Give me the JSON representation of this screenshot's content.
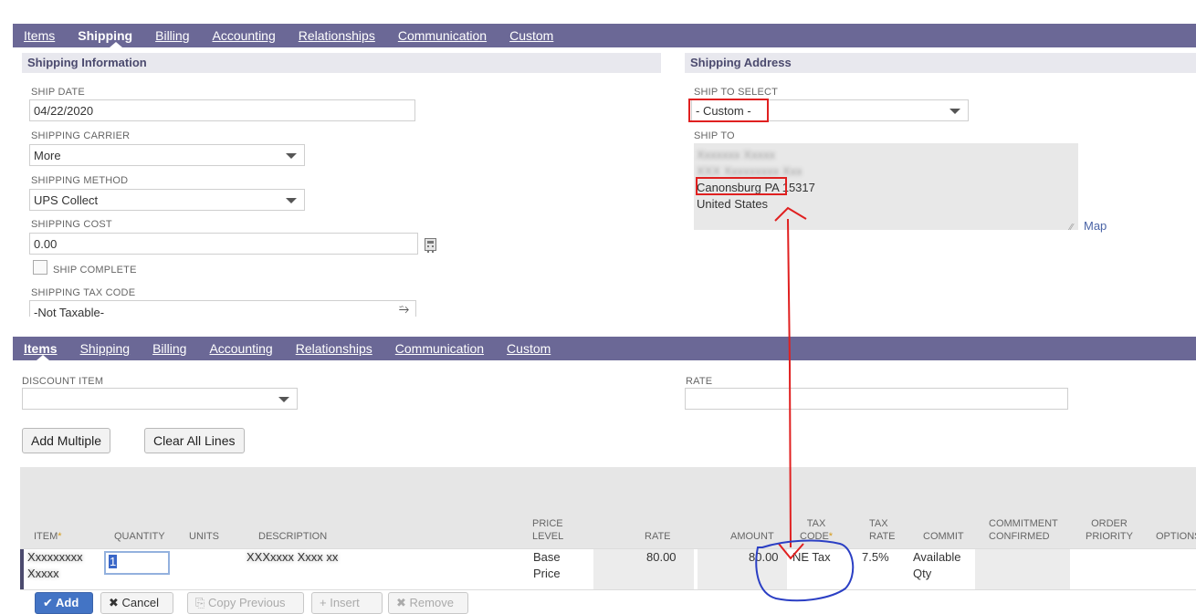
{
  "tabs_top": {
    "items": [
      {
        "label": "Items",
        "active": false
      },
      {
        "label": "Shipping",
        "active": true
      },
      {
        "label": "Billing",
        "active": false
      },
      {
        "label": "Accounting",
        "active": false
      },
      {
        "label": "Relationships",
        "active": false
      },
      {
        "label": "Communication",
        "active": false
      },
      {
        "label": "Custom",
        "active": false
      }
    ]
  },
  "shipping_info": {
    "heading": "Shipping Information",
    "ship_date_label": "SHIP DATE",
    "ship_date": "04/22/2020",
    "carrier_label": "SHIPPING CARRIER",
    "carrier": "More",
    "method_label": "SHIPPING METHOD",
    "method": "UPS Collect",
    "cost_label": "SHIPPING COST",
    "cost": "0.00",
    "ship_complete_label": "SHIP COMPLETE",
    "tax_code_label": "SHIPPING TAX CODE",
    "tax_code": "-Not Taxable-"
  },
  "shipping_address": {
    "heading": "Shipping Address",
    "select_label": "SHIP TO SELECT",
    "select_value": "- Custom -",
    "ship_to_label": "SHIP TO",
    "lines": [
      "Canonsburg PA 15317",
      "United States"
    ],
    "map_link": "Map"
  },
  "tabs_bottom": {
    "items": [
      {
        "label": "Items",
        "active": true
      },
      {
        "label": "Shipping",
        "active": false
      },
      {
        "label": "Billing",
        "active": false
      },
      {
        "label": "Accounting",
        "active": false
      },
      {
        "label": "Relationships",
        "active": false
      },
      {
        "label": "Communication",
        "active": false
      },
      {
        "label": "Custom",
        "active": false
      }
    ]
  },
  "items_section": {
    "discount_label": "DISCOUNT ITEM",
    "rate_label": "RATE",
    "add_multiple": "Add Multiple",
    "clear_all": "Clear All Lines"
  },
  "grid": {
    "headers": {
      "item": "ITEM",
      "quantity": "QUANTITY",
      "units": "UNITS",
      "description": "DESCRIPTION",
      "price_level_1": "PRICE",
      "price_level_2": "LEVEL",
      "rate": "RATE",
      "amount": "AMOUNT",
      "tax_code_1": "TAX",
      "tax_code_2": "CODE",
      "tax_rate_1": "TAX",
      "tax_rate_2": "RATE",
      "commit": "COMMIT",
      "commitment_1": "COMMITMENT",
      "commitment_2": "CONFIRMED",
      "order_priority_1": "ORDER",
      "order_priority_2": "PRIORITY",
      "options": "OPTIONS"
    },
    "row": {
      "quantity": "1",
      "price_level_1": "Base",
      "price_level_2": "Price",
      "rate": "80.00",
      "amount": "80.00",
      "tax_code": "NE Tax",
      "tax_rate": "7.5%",
      "commit_1": "Available",
      "commit_2": "Qty"
    }
  },
  "line_actions": {
    "add": "Add",
    "cancel": "Cancel",
    "copy_previous": "Copy Previous",
    "insert": "Insert",
    "remove": "Remove"
  },
  "colors": {
    "tab_bar": "#6b6896",
    "annotation_red": "#e02020",
    "annotation_blue": "#2b3fc4"
  }
}
